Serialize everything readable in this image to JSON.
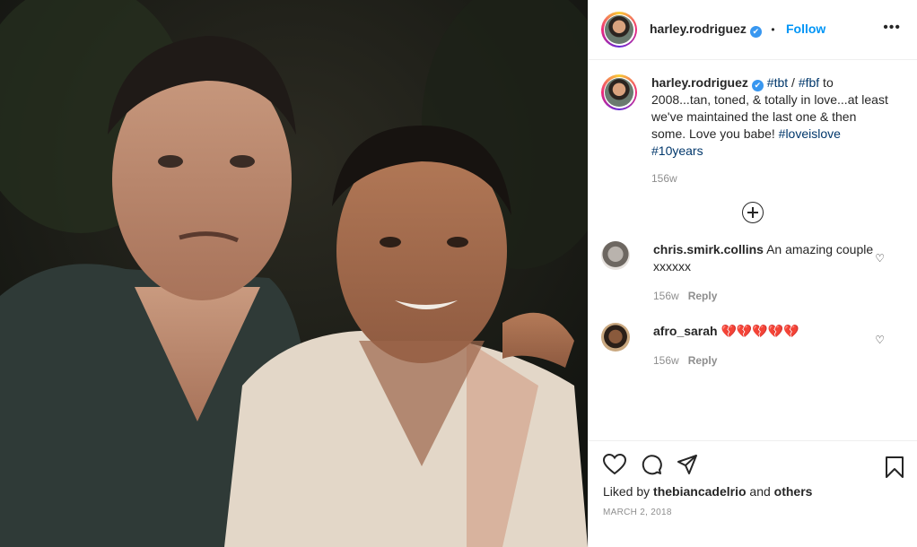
{
  "header": {
    "username": "harley.rodriguez",
    "verified_mark": "✔",
    "follow_label": "Follow",
    "separator": "•",
    "more_label": "•••"
  },
  "caption": {
    "username": "harley.rodriguez",
    "tag1": "#tbt",
    "slash": " / ",
    "tag2": "#fbf",
    "body": " to 2008...tan, toned, & totally in love...at least we've maintained the last one & then some. Love you babe! ",
    "tag3": "#loveislove",
    "space": " ",
    "tag4": "#10years",
    "age": "156w"
  },
  "comments": [
    {
      "username": "chris.smirk.collins",
      "text": " An amazing couple xxxxxx",
      "age": "156w",
      "reply_label": "Reply"
    },
    {
      "username": "afro_sarah",
      "text": " 💔💔💔💔💔",
      "age": "156w",
      "reply_label": "Reply"
    }
  ],
  "footer": {
    "liked_prefix": "Liked by ",
    "liked_user": "thebiancadelrio",
    "liked_and": " and ",
    "liked_others": "others",
    "date": "MARCH 2, 2018"
  },
  "icons": {
    "heart": "♡"
  }
}
